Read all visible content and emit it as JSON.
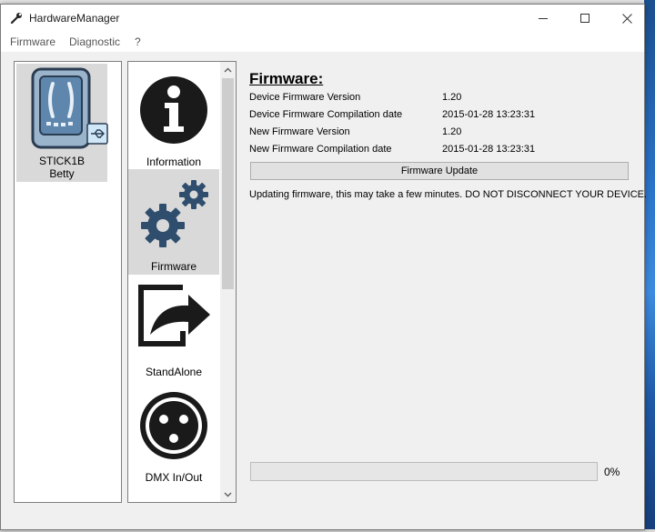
{
  "window": {
    "title": "HardwareManager"
  },
  "menu": {
    "items": [
      "Firmware",
      "Diagnostic",
      "?"
    ]
  },
  "device": {
    "name": "STICK1B",
    "user": "Betty"
  },
  "nav": {
    "items": [
      {
        "label": "Information",
        "icon": "info-icon"
      },
      {
        "label": "Firmware",
        "icon": "gears-icon",
        "selected": true
      },
      {
        "label": "StandAlone",
        "icon": "export-arrow-icon"
      },
      {
        "label": "DMX In/Out",
        "icon": "xlr-connector-icon"
      }
    ]
  },
  "firmware": {
    "title": "Firmware:",
    "rows": [
      {
        "label": "Device Firmware Version",
        "value": "1.20"
      },
      {
        "label": "Device Firmware Compilation date",
        "value": "2015-01-28 13:23:31"
      },
      {
        "label": "New Firmware Version",
        "value": "1.20"
      },
      {
        "label": "New Firmware Compilation date",
        "value": "2015-01-28 13:23:31"
      }
    ],
    "update_button": "Firmware Update",
    "warning": "Updating firmware, this may take a few minutes. DO NOT DISCONNECT YOUR DEVICE."
  },
  "progress": {
    "value": 0,
    "label": "0%"
  },
  "colors": {
    "selection": "#d9d9d9",
    "icon_dark": "#1a1a1a",
    "gear_blue": "#2f4e6e",
    "progress": "#06b025"
  }
}
